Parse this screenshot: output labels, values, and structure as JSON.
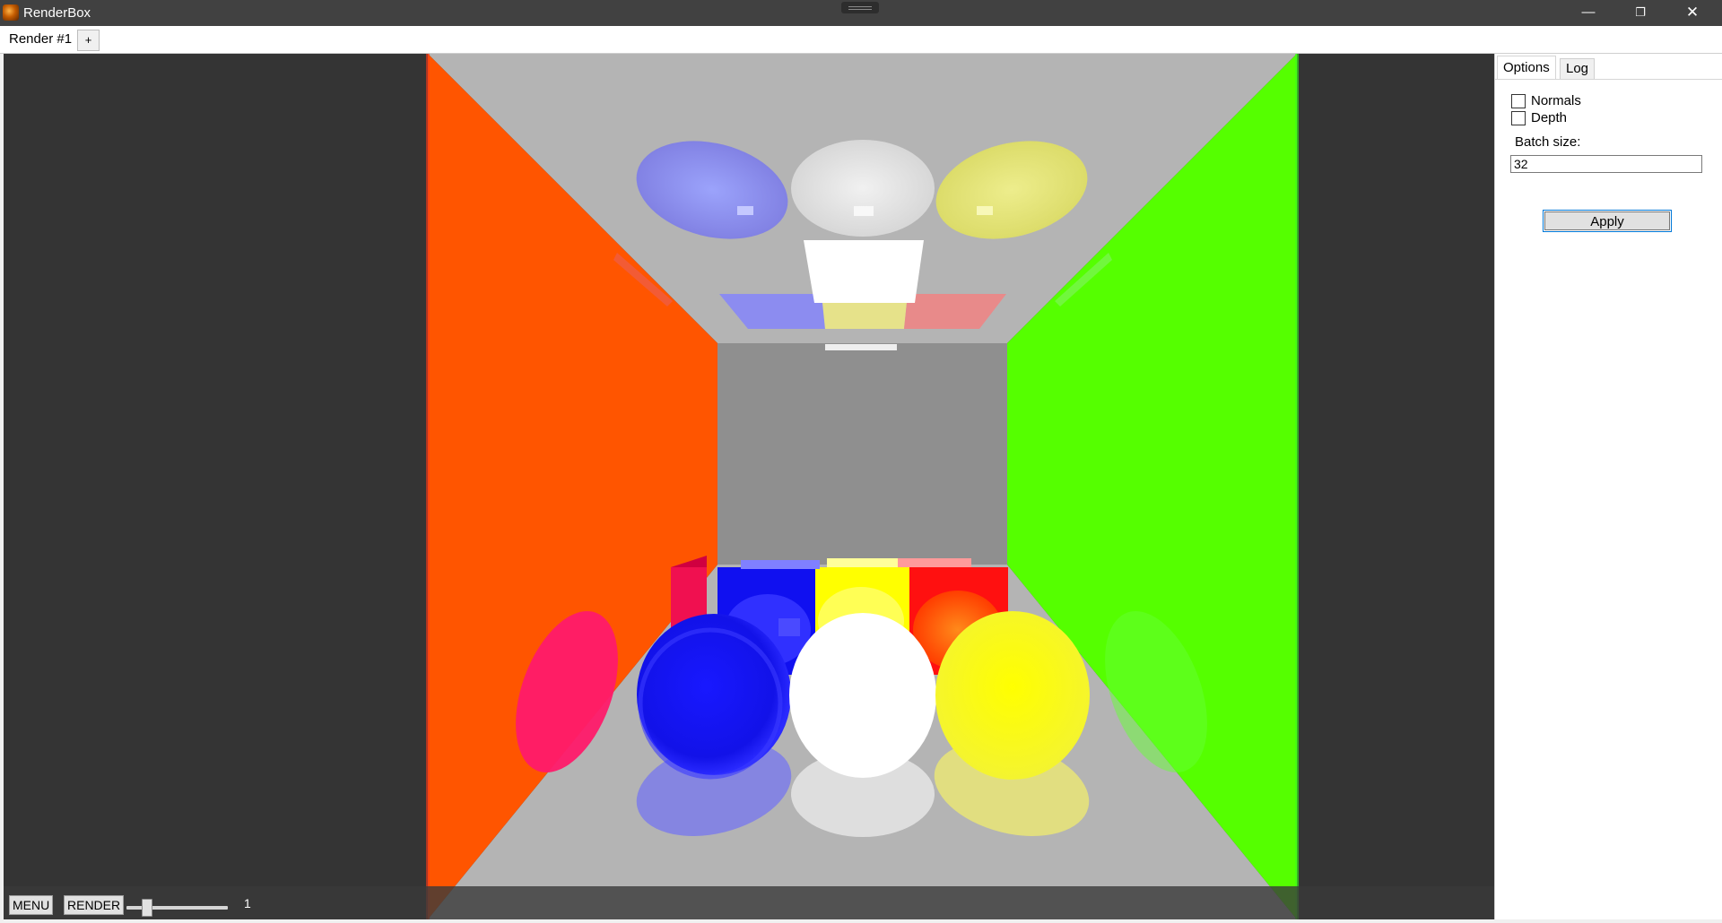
{
  "window": {
    "title": "RenderBox",
    "app_icon": "renderbox-app-icon",
    "controls": {
      "minimize": "—",
      "maximize": "❐",
      "close": "✕"
    }
  },
  "document_tabs": {
    "items": [
      {
        "label": "Render #1"
      }
    ],
    "add_label": "+"
  },
  "viewport": {
    "content": "rendered-cornell-box-scene",
    "colors": {
      "background": "#343434",
      "left_wall": "#ff5500",
      "right_wall": "#55ff00",
      "back_wall": "#8f8f8f",
      "ceiling_floor": "#b4b4b4",
      "sphere_blue": "#1a1aff",
      "sphere_white": "#ffffff",
      "sphere_yellow": "#ffff10"
    },
    "controls": {
      "menu_label": "MENU",
      "render_label": "RENDER",
      "slider_value": "1"
    }
  },
  "side_panel": {
    "tabs": [
      {
        "label": "Options",
        "active": true
      },
      {
        "label": "Log",
        "active": false
      }
    ],
    "options": {
      "normals_label": "Normals",
      "normals_checked": false,
      "depth_label": "Depth",
      "depth_checked": false,
      "batch_size_label": "Batch size:",
      "batch_size_value": "32",
      "apply_label": "Apply"
    }
  }
}
